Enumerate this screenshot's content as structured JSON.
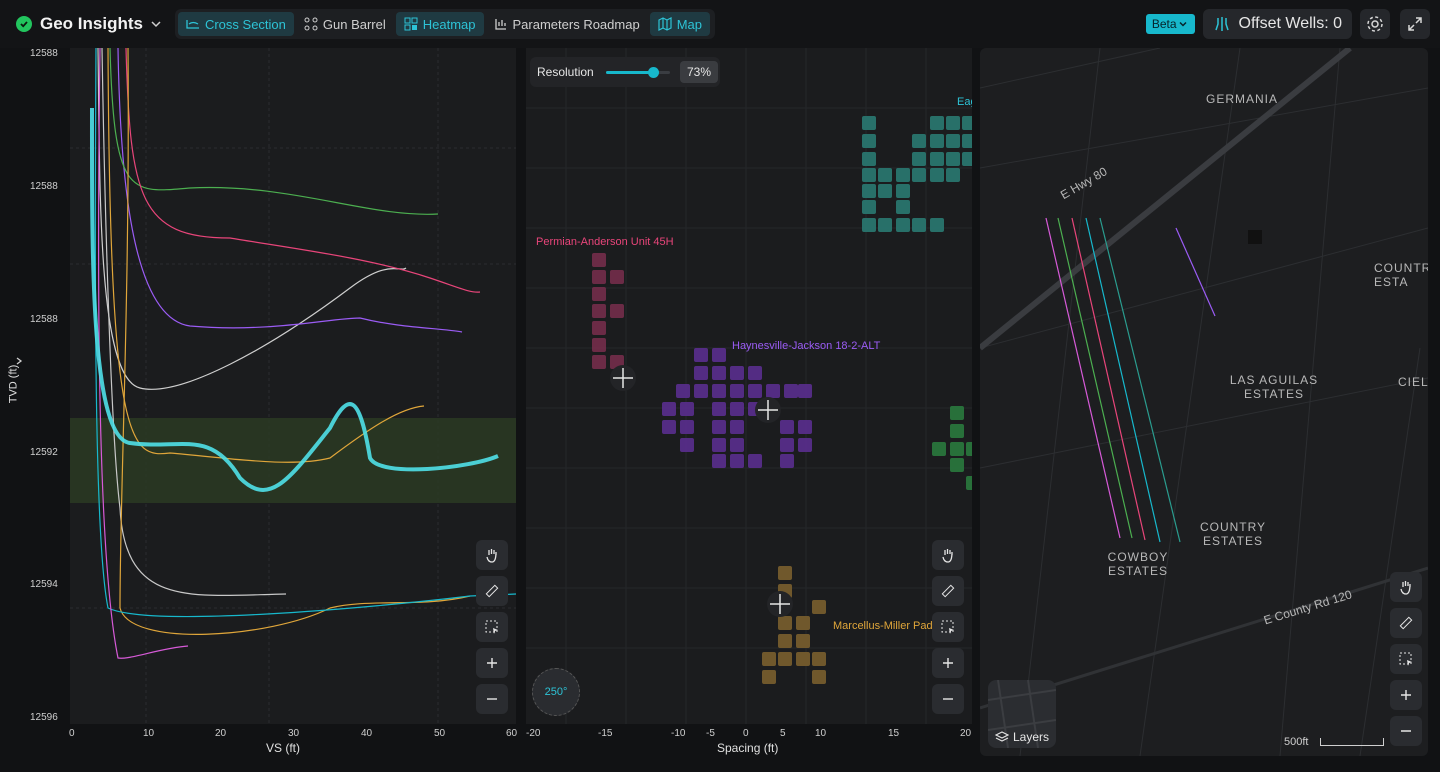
{
  "app": {
    "title": "Geo Insights",
    "status_color": "#22c55e"
  },
  "tabs": [
    {
      "label": "Cross Section",
      "icon": "cross-section-icon"
    },
    {
      "label": "Gun Barrel",
      "icon": "gun-barrel-icon"
    },
    {
      "label": "Heatmap",
      "icon": "heatmap-icon"
    },
    {
      "label": "Parameters Roadmap",
      "icon": "roadmap-icon"
    },
    {
      "label": "Map",
      "icon": "map-icon"
    }
  ],
  "header": {
    "beta_label": "Beta",
    "offset_wells_label": "Offset Wells: 0"
  },
  "cross_section": {
    "y_axis_title": "TVD (ft)",
    "x_axis_title": "VS (ft)",
    "y_ticks": [
      "12588",
      "12588",
      "12588",
      "12592",
      "12594",
      "12596"
    ],
    "x_ticks": [
      "0",
      "10",
      "20",
      "30",
      "40",
      "50",
      "60"
    ]
  },
  "heatmap": {
    "resolution_label": "Resolution",
    "resolution_value": "73%",
    "resolution_fraction": 0.73,
    "x_axis_title": "Spacing (ft)",
    "x_ticks": [
      "-20",
      "-15",
      "-10",
      "-5",
      "0",
      "5",
      "10",
      "15",
      "20"
    ],
    "well_labels": [
      {
        "text": "Permian-Anderson Unit 45H",
        "color": "#e8457a"
      },
      {
        "text": "Haynesville-Jackson 18-2-ALT",
        "color": "#9b5cf5"
      },
      {
        "text": "Marcellus-Miller Pad",
        "color": "#e0a63a"
      },
      {
        "text": "Eag",
        "color": "#2dc3d6"
      }
    ],
    "compass_value": "250°"
  },
  "map": {
    "places": [
      "GERMANIA",
      "LAS AGUILAS ESTATES",
      "COUNTRY ESTATES",
      "COWBOY ESTATES",
      "COUNTR ESTA",
      "CIEL"
    ],
    "roads": [
      "E Hwy 80",
      "E County Rd 120"
    ],
    "scale_label": "500ft",
    "layers_label": "Layers"
  },
  "colors": {
    "accent": "#17b8cc",
    "pink": "#e8457a",
    "purple": "#9b5cf5",
    "orange": "#e0a63a",
    "teal": "#2a9d8f",
    "green": "#4caf50"
  }
}
